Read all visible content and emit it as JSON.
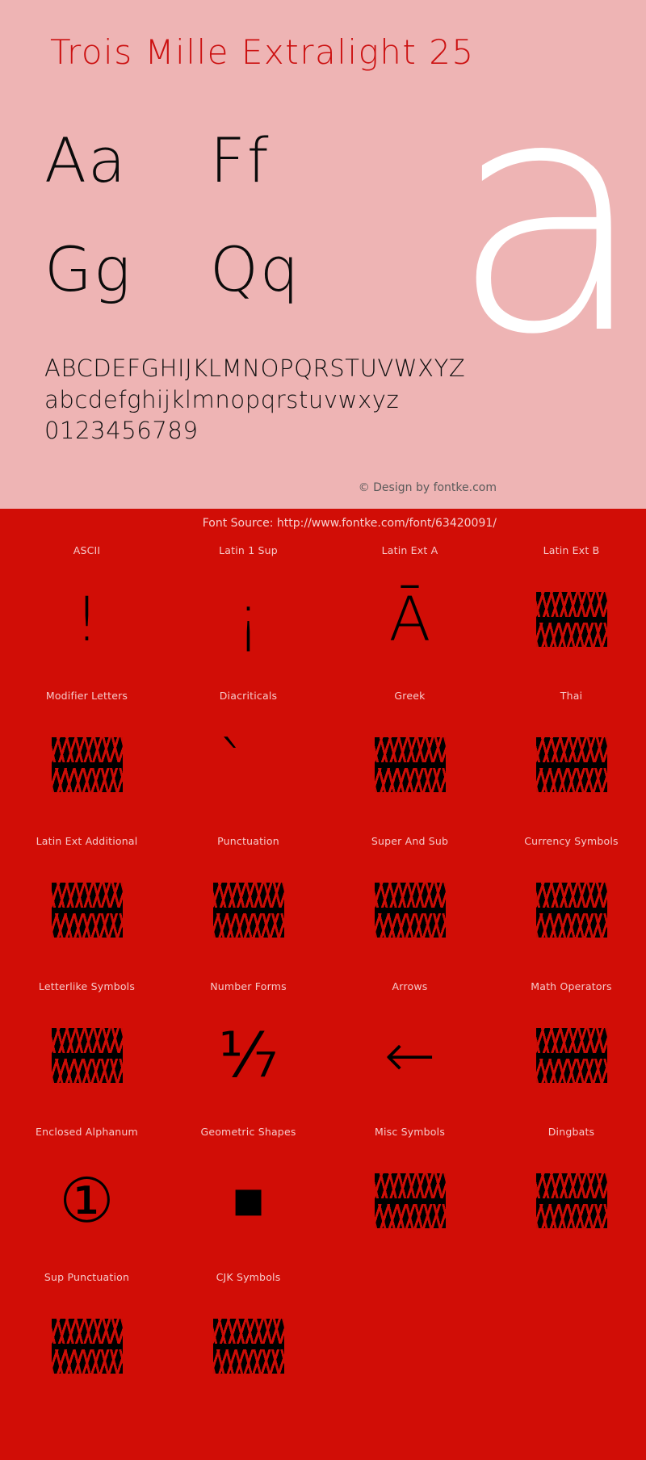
{
  "specimen": {
    "title": "Trois Mille Extralight 25",
    "big_glyph": "a",
    "letter_pairs": [
      [
        "Aa",
        "Ff"
      ],
      [
        "Gg",
        "Qq"
      ]
    ],
    "alphabet_lines": [
      "ABCDEFGHIJKLMNOPQRSTUVWXYZ",
      "abcdefghijklmnopqrstuvwxyz",
      "0123456789"
    ],
    "copyright": "© Design by fontke.com",
    "background_color": "#eeb4b4",
    "title_color": "#cc1111",
    "big_glyph_color": "#ffffff"
  },
  "coverage": {
    "source_line": "Font Source: http://www.fontke.com/font/63420091/",
    "background_color": "#d10d06",
    "label_color": "#f6c9c9",
    "glyph_color": "#000000",
    "blocks": [
      {
        "label": "ASCII",
        "sample": "!",
        "kind": "glyph"
      },
      {
        "label": "Latin 1 Sup",
        "sample": "¡",
        "kind": "glyph"
      },
      {
        "label": "Latin Ext A",
        "sample": "Ā",
        "kind": "glyph"
      },
      {
        "label": "Latin Ext B",
        "sample": "",
        "kind": "tofu"
      },
      {
        "label": "Modifier Letters",
        "sample": "",
        "kind": "tofu"
      },
      {
        "label": "Diacriticals",
        "sample": "̀",
        "kind": "glyph"
      },
      {
        "label": "Greek",
        "sample": "",
        "kind": "tofu"
      },
      {
        "label": "Thai",
        "sample": "",
        "kind": "tofu"
      },
      {
        "label": "Latin Ext Additional",
        "sample": "",
        "kind": "tofu"
      },
      {
        "label": "Punctuation",
        "sample": "",
        "kind": "tofu"
      },
      {
        "label": "Super And Sub",
        "sample": "",
        "kind": "tofu"
      },
      {
        "label": "Currency Symbols",
        "sample": "",
        "kind": "tofu"
      },
      {
        "label": "Letterlike Symbols",
        "sample": "",
        "kind": "tofu"
      },
      {
        "label": "Number Forms",
        "sample": "⅐",
        "kind": "glyph"
      },
      {
        "label": "Arrows",
        "sample": "←",
        "kind": "glyph"
      },
      {
        "label": "Math Operators",
        "sample": "",
        "kind": "tofu"
      },
      {
        "label": "Enclosed Alphanum",
        "sample": "①",
        "kind": "glyph"
      },
      {
        "label": "Geometric Shapes",
        "sample": "■",
        "kind": "glyph"
      },
      {
        "label": "Misc Symbols",
        "sample": "",
        "kind": "tofu"
      },
      {
        "label": "Dingbats",
        "sample": "",
        "kind": "tofu"
      },
      {
        "label": "Sup Punctuation",
        "sample": "",
        "kind": "tofu"
      },
      {
        "label": "CJK Symbols",
        "sample": "",
        "kind": "tofu"
      }
    ]
  }
}
